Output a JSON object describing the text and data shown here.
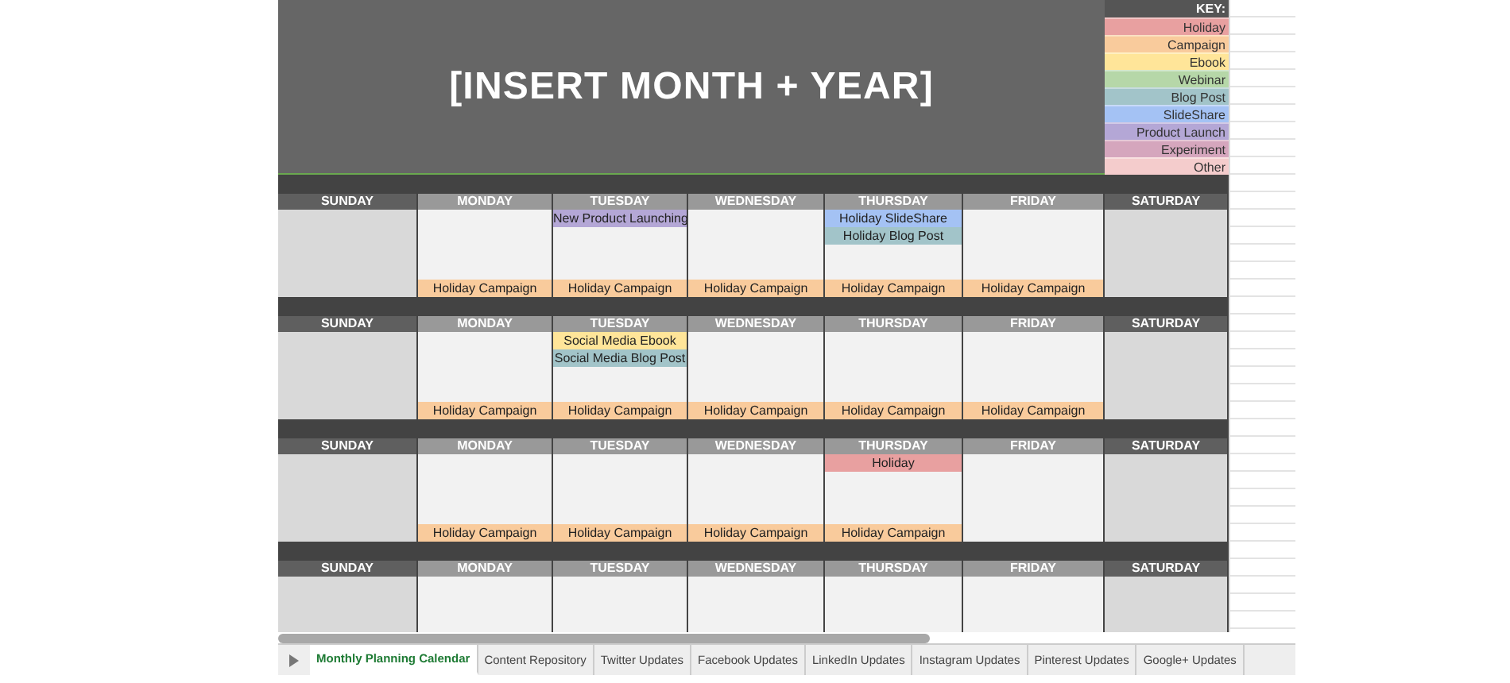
{
  "title": "[INSERT MONTH + YEAR]",
  "key": {
    "heading": "KEY:",
    "items": [
      {
        "label": "Holiday",
        "color": "#e8a0a0"
      },
      {
        "label": "Campaign",
        "color": "#f9cb9c"
      },
      {
        "label": "Ebook",
        "color": "#ffe599"
      },
      {
        "label": "Webinar",
        "color": "#b6d7a8"
      },
      {
        "label": "Blog Post",
        "color": "#a2c4c9"
      },
      {
        "label": "SlideShare",
        "color": "#a4c2f4"
      },
      {
        "label": "Product Launch",
        "color": "#b4a7d6"
      },
      {
        "label": "Experiment",
        "color": "#d5a6bd"
      },
      {
        "label": "Other",
        "color": "#f4cccc"
      }
    ]
  },
  "weeks": [
    {
      "days": [
        {
          "name": "SUNDAY",
          "weekend": true
        },
        {
          "name": "MONDAY",
          "weekend": false,
          "bottom": [
            {
              "label": "Holiday Campaign",
              "color": "#f9cb9c"
            }
          ]
        },
        {
          "name": "TUESDAY",
          "weekend": false,
          "top": [
            {
              "label": "New Product Launching",
              "color": "#b4a7d6"
            }
          ],
          "bottom": [
            {
              "label": "Holiday Campaign",
              "color": "#f9cb9c"
            }
          ]
        },
        {
          "name": "WEDNESDAY",
          "weekend": false,
          "bottom": [
            {
              "label": "Holiday Campaign",
              "color": "#f9cb9c"
            }
          ]
        },
        {
          "name": "THURSDAY",
          "weekend": false,
          "top": [
            {
              "label": "Holiday SlideShare",
              "color": "#a4c2f4"
            },
            {
              "label": "Holiday Blog Post",
              "color": "#a2c4c9"
            }
          ],
          "bottom": [
            {
              "label": "Holiday Campaign",
              "color": "#f9cb9c"
            }
          ]
        },
        {
          "name": "FRIDAY",
          "weekend": false,
          "bottom": [
            {
              "label": "Holiday Campaign",
              "color": "#f9cb9c"
            }
          ]
        },
        {
          "name": "SATURDAY",
          "weekend": true
        }
      ]
    },
    {
      "days": [
        {
          "name": "SUNDAY",
          "weekend": true
        },
        {
          "name": "MONDAY",
          "weekend": false,
          "bottom": [
            {
              "label": "Holiday Campaign",
              "color": "#f9cb9c"
            }
          ]
        },
        {
          "name": "TUESDAY",
          "weekend": false,
          "top": [
            {
              "label": "Social Media Ebook",
              "color": "#ffe599"
            },
            {
              "label": "Social Media Blog Post",
              "color": "#a2c4c9"
            }
          ],
          "bottom": [
            {
              "label": "Holiday Campaign",
              "color": "#f9cb9c"
            }
          ]
        },
        {
          "name": "WEDNESDAY",
          "weekend": false,
          "bottom": [
            {
              "label": "Holiday Campaign",
              "color": "#f9cb9c"
            }
          ]
        },
        {
          "name": "THURSDAY",
          "weekend": false,
          "bottom": [
            {
              "label": "Holiday Campaign",
              "color": "#f9cb9c"
            }
          ]
        },
        {
          "name": "FRIDAY",
          "weekend": false,
          "bottom": [
            {
              "label": "Holiday Campaign",
              "color": "#f9cb9c"
            }
          ]
        },
        {
          "name": "SATURDAY",
          "weekend": true
        }
      ]
    },
    {
      "days": [
        {
          "name": "SUNDAY",
          "weekend": true
        },
        {
          "name": "MONDAY",
          "weekend": false,
          "bottom": [
            {
              "label": "Holiday Campaign",
              "color": "#f9cb9c"
            }
          ]
        },
        {
          "name": "TUESDAY",
          "weekend": false,
          "bottom": [
            {
              "label": "Holiday Campaign",
              "color": "#f9cb9c"
            }
          ]
        },
        {
          "name": "WEDNESDAY",
          "weekend": false,
          "bottom": [
            {
              "label": "Holiday Campaign",
              "color": "#f9cb9c"
            }
          ]
        },
        {
          "name": "THURSDAY",
          "weekend": false,
          "top": [
            {
              "label": "Holiday",
              "color": "#e8a0a0"
            }
          ],
          "bottom": [
            {
              "label": "Holiday Campaign",
              "color": "#f9cb9c"
            }
          ]
        },
        {
          "name": "FRIDAY",
          "weekend": false
        },
        {
          "name": "SATURDAY",
          "weekend": true
        }
      ]
    },
    {
      "days": [
        {
          "name": "SUNDAY",
          "weekend": true
        },
        {
          "name": "MONDAY",
          "weekend": false
        },
        {
          "name": "TUESDAY",
          "weekend": false
        },
        {
          "name": "WEDNESDAY",
          "weekend": false
        },
        {
          "name": "THURSDAY",
          "weekend": false
        },
        {
          "name": "FRIDAY",
          "weekend": false
        },
        {
          "name": "SATURDAY",
          "weekend": true
        }
      ]
    }
  ],
  "sheet_tabs": [
    {
      "label": "Monthly Planning Calendar",
      "selected": true
    },
    {
      "label": "Content Repository",
      "selected": false
    },
    {
      "label": "Twitter Updates",
      "selected": false
    },
    {
      "label": "Facebook Updates",
      "selected": false
    },
    {
      "label": "LinkedIn Updates",
      "selected": false
    },
    {
      "label": "Instagram Updates",
      "selected": false
    },
    {
      "label": "Pinterest Updates",
      "selected": false
    },
    {
      "label": "Google+ Updates",
      "selected": false
    }
  ]
}
